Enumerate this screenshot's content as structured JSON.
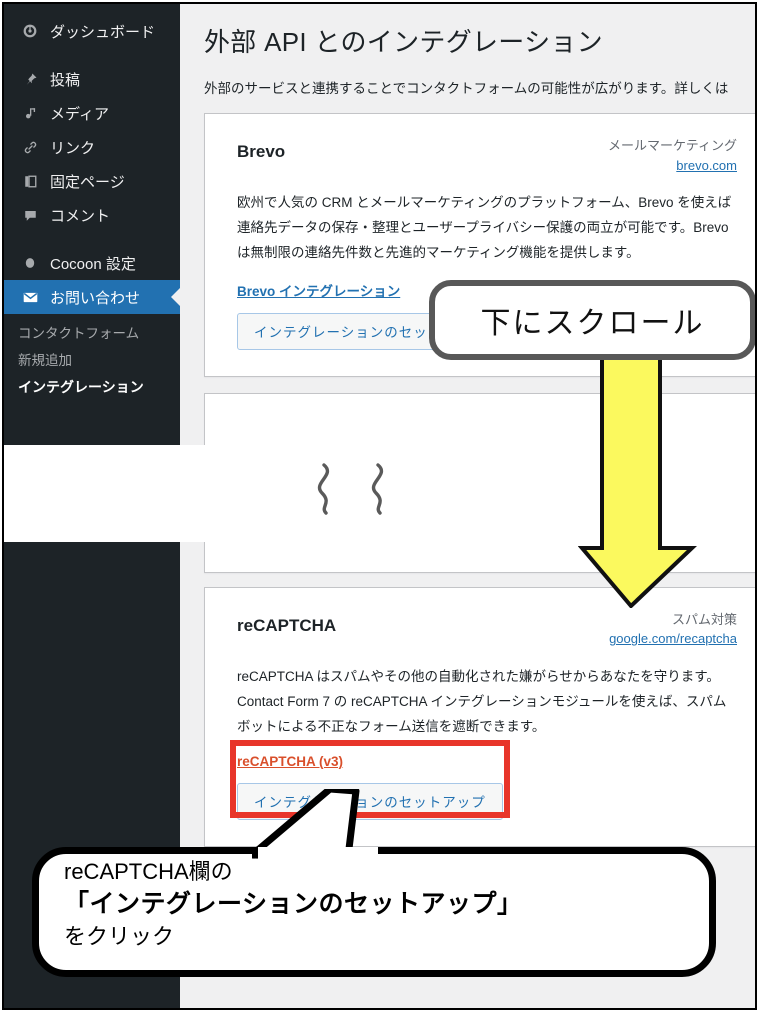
{
  "sidebar": {
    "items": [
      {
        "icon": "dashboard-icon",
        "glyph": "◉",
        "label": "ダッシュボード"
      },
      {
        "icon": "pin-icon",
        "glyph": "✒",
        "label": "投稿"
      },
      {
        "icon": "media-icon",
        "glyph": "♫",
        "label": "メディア"
      },
      {
        "icon": "link-icon",
        "glyph": "🔗",
        "label": "リンク"
      },
      {
        "icon": "page-icon",
        "glyph": "❐",
        "label": "固定ページ"
      },
      {
        "icon": "comment-icon",
        "glyph": "🗩",
        "label": "コメント"
      },
      {
        "icon": "cocoon-icon",
        "glyph": "⬤",
        "label": "Cocoon 設定"
      },
      {
        "icon": "mail-icon",
        "glyph": "✉",
        "label": "お問い合わせ",
        "active": true
      }
    ],
    "submenu": [
      {
        "label": "コンタクトフォーム",
        "current": false
      },
      {
        "label": "新規追加",
        "current": false
      },
      {
        "label": "インテグレーション",
        "current": true
      }
    ]
  },
  "main": {
    "title": "外部 API とのインテグレーション",
    "description": "外部のサービスと連携することでコンタクトフォームの可能性が広がります。詳しくは",
    "cards": [
      {
        "name": "brevo",
        "title": "Brevo",
        "category": "メールマーケティング",
        "url": "brevo.com",
        "body": "欧州で人気の CRM とメールマーケティングのプラットフォーム、Brevo を使えば連絡先データの保存・整理とユーザープライバシー保護の両立が可能です。Brevo は無制限の連絡先件数と先進的マーケティング機能を提供します。",
        "link": "Brevo インテグレーション",
        "button": "インテグレーションのセットアップ"
      },
      {
        "name": "recaptcha",
        "title": "reCAPTCHA",
        "category": "スパム対策",
        "url": "google.com/recaptcha",
        "body": "reCAPTCHA はスパムやその他の自動化された嫌がらせからあなたを守ります。Contact Form 7 の reCAPTCHA インテグレーションモジュールを使えば、スパムボットによる不正なフォーム送信を遮断できます。",
        "link": "reCAPTCHA (v3)",
        "button": "インテグレーションのセットアップ"
      }
    ]
  },
  "annotations": {
    "scroll_label": "下にスクロール",
    "arrow": "down-arrow",
    "callout_line1": "reCAPTCHA欄の",
    "callout_line2": "「インテグレーションのセットアップ」",
    "callout_line3": "をクリック"
  },
  "colors": {
    "sidebar_bg": "#1d2327",
    "accent_blue": "#2271b1",
    "highlight_yellow": "#fbf95e",
    "alert_red": "#e8352a",
    "link_red": "#d94f2b"
  }
}
